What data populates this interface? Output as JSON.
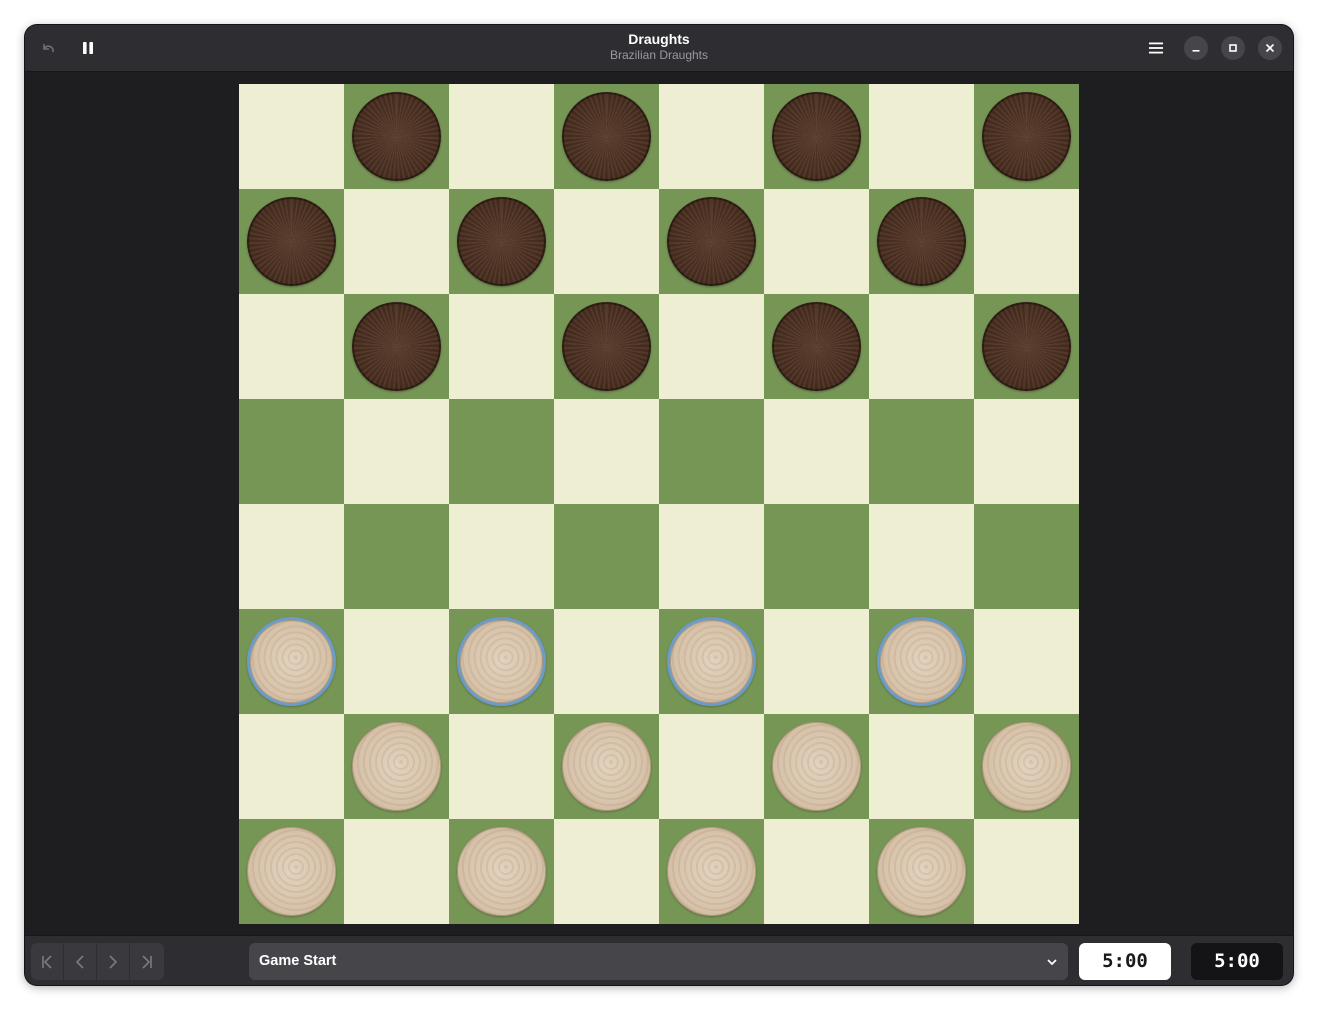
{
  "window": {
    "title": "Draughts",
    "subtitle": "Brazilian Draughts"
  },
  "header": {
    "undo_icon": "undo-icon",
    "pause_icon": "pause-icon",
    "menu_icon": "hamburger-menu-icon",
    "minimize_icon": "minimize-icon",
    "maximize_icon": "maximize-icon",
    "close_icon": "close-icon"
  },
  "board": {
    "size": 8,
    "light_color": "#eeeed2",
    "dark_color": "#769656",
    "rows": [
      ".b.b.b.b",
      "b.b.b.b.",
      ".b.b.b.b",
      "........",
      "........",
      "w.w.w.w.",
      ".w.w.w.w",
      "w.w.w.w."
    ],
    "movable_row_index": 5,
    "piece_colors": {
      "black": "#4a2f20",
      "white": "#d7c3aa",
      "highlight": "#6a9bc9"
    }
  },
  "footer": {
    "nav_icons": [
      "first-move-icon",
      "previous-move-icon",
      "next-move-icon",
      "last-move-icon"
    ],
    "move_selector": "Game Start",
    "clock_white": "5:00",
    "clock_black": "5:00"
  }
}
